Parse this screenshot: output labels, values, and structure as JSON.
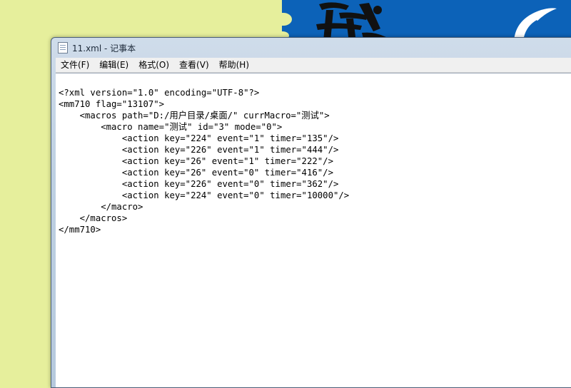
{
  "window": {
    "title": "11.xml - 记事本"
  },
  "menu": [
    "文件(F)",
    "编辑(E)",
    "格式(O)",
    "查看(V)",
    "帮助(H)"
  ],
  "editor": {
    "lines": [
      "<?xml version=\"1.0\" encoding=\"UTF-8\"?>",
      "<mm710 flag=\"13107\">",
      "    <macros path=\"D:/用户目录/桌面/\" currMacro=\"测试\">",
      "        <macro name=\"测试\" id=\"3\" mode=\"0\">",
      "            <action key=\"224\" event=\"1\" timer=\"135\"/>",
      "            <action key=\"226\" event=\"1\" timer=\"444\"/>",
      "            <action key=\"26\" event=\"1\" timer=\"222\"/>",
      "            <action key=\"26\" event=\"0\" timer=\"416\"/>",
      "            <action key=\"226\" event=\"0\" timer=\"362\"/>",
      "            <action key=\"224\" event=\"0\" timer=\"10000\"/>",
      "        </macro>",
      "    </macros>",
      "</mm710>"
    ]
  },
  "colors": {
    "desktop": "#e6ef9c",
    "wallpaper_blue": "#0c62b8"
  },
  "icons": {
    "app": "notepad-icon"
  }
}
